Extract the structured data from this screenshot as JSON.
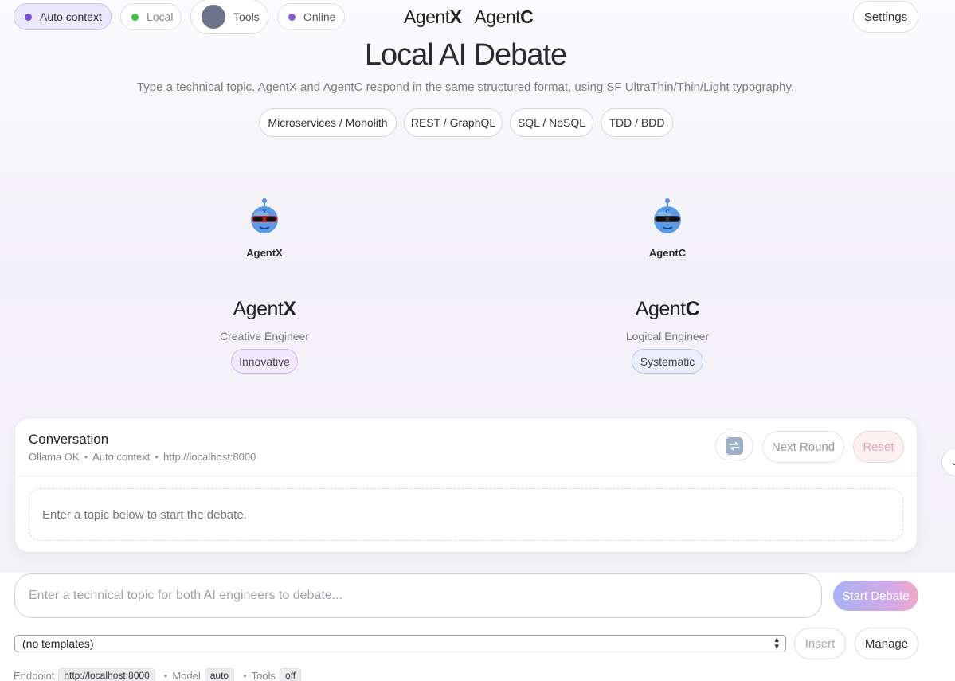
{
  "topbar": {
    "pills": [
      {
        "label": "Auto context",
        "dot": "#7b4fd6",
        "active": true
      },
      {
        "label": "Local",
        "dot": "#3bbf4a",
        "active": false
      },
      {
        "label": "Tools",
        "active": false
      },
      {
        "label": "Online",
        "dot": "#8a5ad0",
        "active": false
      }
    ],
    "brand": {
      "x_prefix": "Agent",
      "x_suffix": "X",
      "c_prefix": "Agent",
      "c_suffix": "C"
    },
    "settings_label": "Settings"
  },
  "hero": {
    "title": "Local AI Debate",
    "subtitle": "Type a technical topic. AgentX and AgentC respond in the same structured format, using SF UltraThin/Thin/Light typography.",
    "topics": [
      "Microservices / Monolith",
      "REST / GraphQL",
      "SQL / NoSQL",
      "TDD / BDD"
    ]
  },
  "agents": [
    {
      "caption": "AgentX",
      "name_prefix": "Agent",
      "name_suffix": "X",
      "role": "Creative Engineer",
      "trait": "Innovative",
      "trait_bg": "#f1e8fb",
      "trait_border": "#cfb8ea",
      "glasses": "#c02020"
    },
    {
      "caption": "AgentC",
      "name_prefix": "Agent",
      "name_suffix": "C",
      "role": "Logical Engineer",
      "trait": "Systematic",
      "trait_bg": "#e8eefa",
      "trait_border": "#b6c6e6",
      "glasses": "#333333"
    }
  ],
  "conversation": {
    "title": "Conversation",
    "status": "Ollama OK",
    "context": "Auto context",
    "endpoint": "http://localhost:8000",
    "next_round_label": "Next Round",
    "reset_label": "Reset",
    "empty_message": "Enter a topic below to start the debate."
  },
  "composer": {
    "placeholder": "Enter a technical topic for both AI engineers to debate...",
    "start_label": "Start Debate",
    "template_value": "(no templates)",
    "insert_label": "Insert",
    "manage_label": "Manage"
  },
  "footer": {
    "endpoint_label": "Endpoint",
    "endpoint_value": "http://localhost:8000",
    "model_label": "Model",
    "model_value": "auto",
    "tools_label": "Tools",
    "tools_value": "off"
  }
}
